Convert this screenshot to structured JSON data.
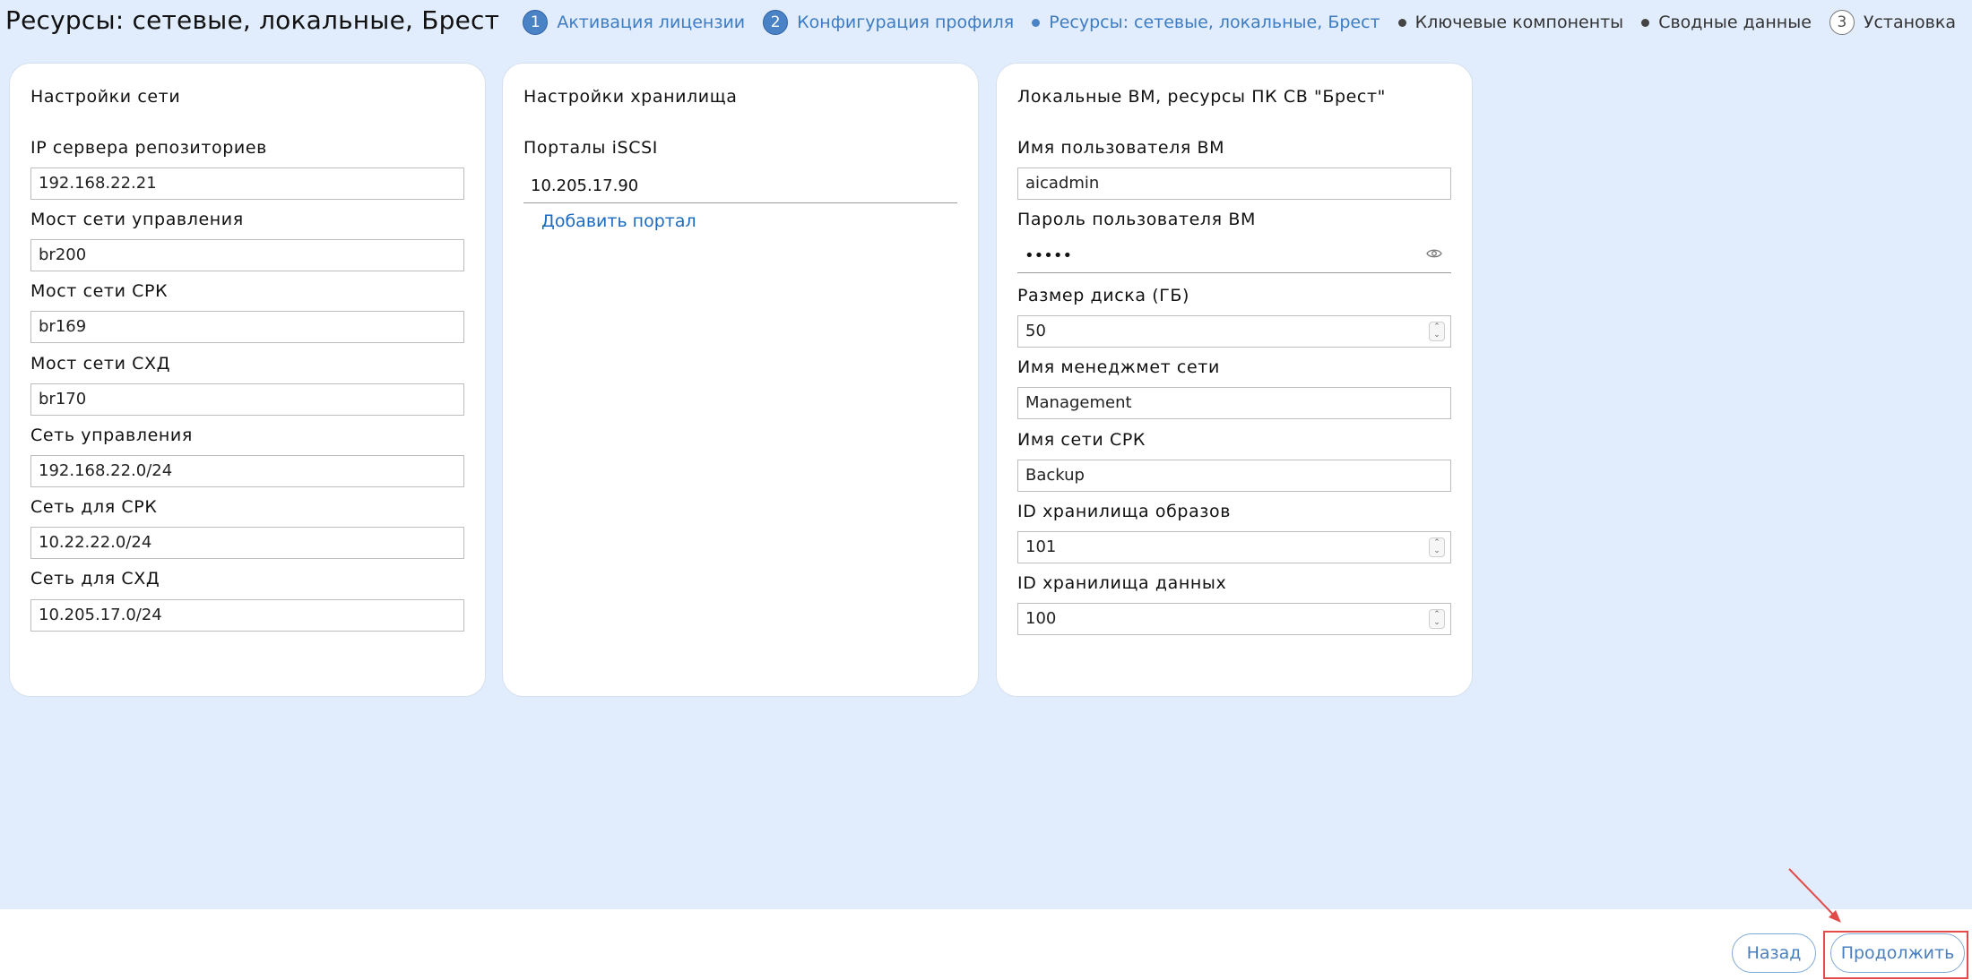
{
  "header": {
    "title": "Ресурсы: сетевые, локальные, Брест",
    "steps": [
      {
        "number": "1",
        "label": "Активация лицензии",
        "state": "done"
      },
      {
        "number": "2",
        "label": "Конфигурация профиля",
        "state": "done"
      },
      {
        "number": "",
        "label": "Ресурсы: сетевые, локальные, Брест",
        "state": "current"
      },
      {
        "number": "",
        "label": "Ключевые компоненты",
        "state": "pending"
      },
      {
        "number": "",
        "label": "Сводные данные",
        "state": "pending"
      },
      {
        "number": "3",
        "label": "Установка",
        "state": "future"
      }
    ]
  },
  "network": {
    "title": "Настройки сети",
    "fields": [
      {
        "label": "IP сервера репозиториев",
        "value": "192.168.22.21"
      },
      {
        "label": "Мост сети управления",
        "value": "br200"
      },
      {
        "label": "Мост сети СРК",
        "value": "br169"
      },
      {
        "label": "Мост сети СХД",
        "value": "br170"
      },
      {
        "label": "Сеть управления",
        "value": "192.168.22.0/24"
      },
      {
        "label": "Сеть для СРК",
        "value": "10.22.22.0/24"
      },
      {
        "label": "Сеть для СХД",
        "value": "10.205.17.0/24"
      }
    ]
  },
  "storage": {
    "title": "Настройки хранилища",
    "portals_label": "Порталы iSCSI",
    "portal_value": "10.205.17.90",
    "add_portal": "Добавить портал"
  },
  "local_vm": {
    "title": "Локальные ВМ, ресурсы ПК СВ \"Брест\"",
    "username_label": "Имя пользователя ВМ",
    "username_value": "aicadmin",
    "password_label": "Пароль пользователя ВМ",
    "password_value": "•••••",
    "disk_label": "Размер диска (ГБ)",
    "disk_value": "50",
    "mgmt_net_label": "Имя менеджмет сети",
    "mgmt_net_value": "Management",
    "srk_net_label": "Имя сети СРК",
    "srk_net_value": "Backup",
    "image_store_label": "ID хранилища образов",
    "image_store_value": "101",
    "data_store_label": "ID хранилища данных",
    "data_store_value": "100"
  },
  "footer": {
    "back_label": "Назад",
    "continue_label": "Продолжить"
  },
  "colors": {
    "background": "#e1edfd",
    "accent": "#4a82c6",
    "link": "#1c6ac0",
    "highlight": "#e34b4b"
  }
}
